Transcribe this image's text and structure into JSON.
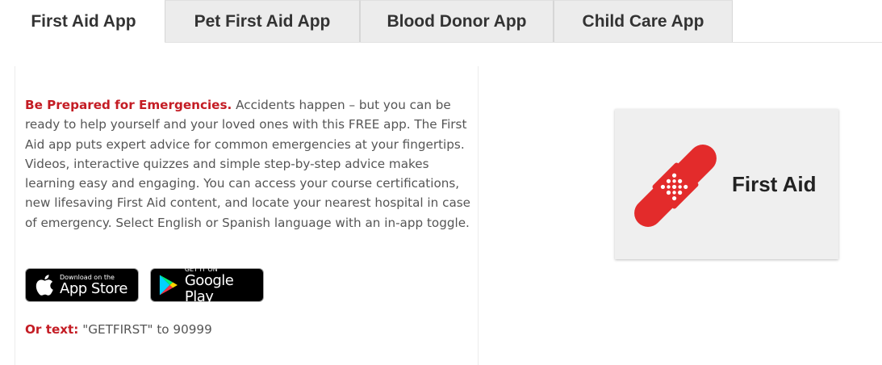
{
  "tabs": [
    {
      "label": "First Aid App",
      "active": true
    },
    {
      "label": "Pet First Aid App",
      "active": false
    },
    {
      "label": "Blood Donor App",
      "active": false
    },
    {
      "label": "Child Care App",
      "active": false
    }
  ],
  "content": {
    "headline": "Be Prepared for Emergencies.",
    "body": " Accidents happen – but you can be ready to help yourself and your loved ones with this FREE app. The First Aid app puts expert advice for common emergencies at your fingertips. Videos, interactive quizzes and simple step-by-step advice makes learning easy and engaging. You can access your course certifications, new lifesaving First Aid content, and locate your nearest hospital in case of emergency. Select English or Spanish language with an in-app toggle.",
    "app_store": {
      "small": "Download on the",
      "big": "App Store",
      "icon": "apple-icon"
    },
    "google_play": {
      "small": "GET IT ON",
      "big": "Google Play",
      "icon": "google-play-icon"
    },
    "or_text_label": "Or text:",
    "or_text_value": " \"GETFIRST\" to 90999"
  },
  "app_card": {
    "title": "First Aid",
    "icon": "bandage-icon"
  },
  "colors": {
    "accent_red": "#c41c24",
    "bandage_red": "#e32b2b",
    "tab_inactive": "#ececec"
  }
}
